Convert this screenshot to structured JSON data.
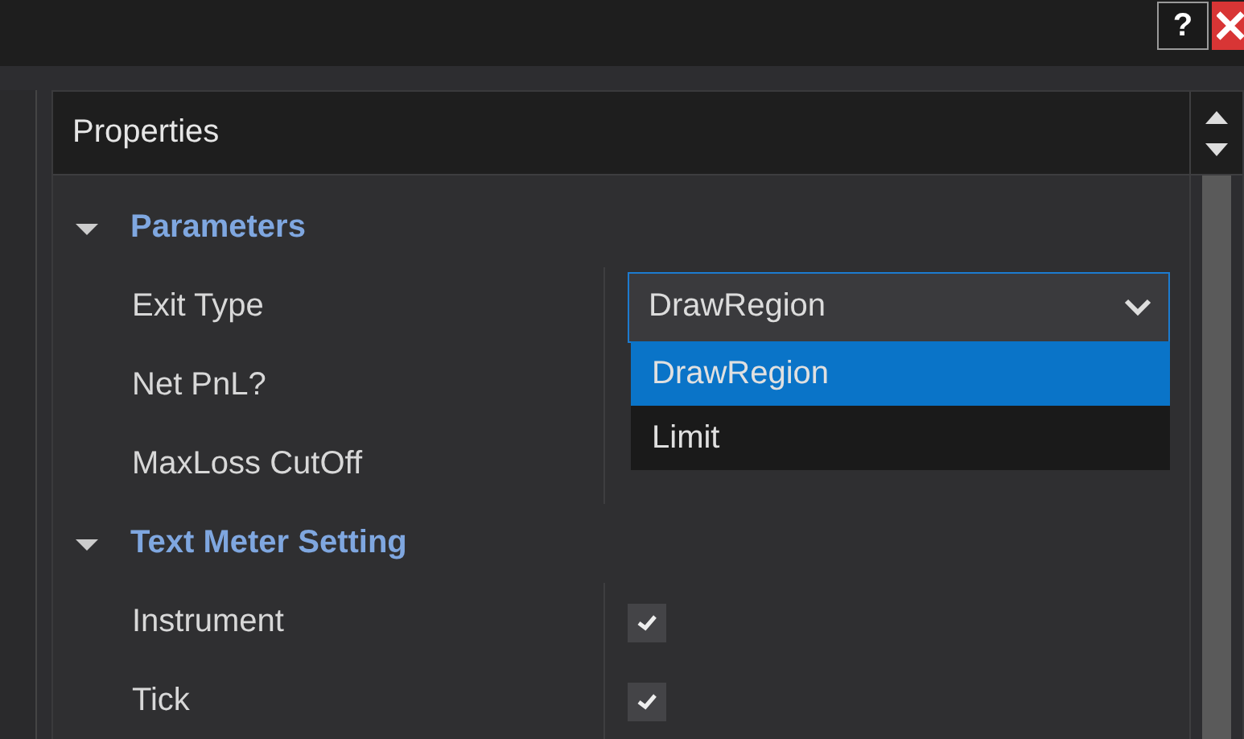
{
  "window": {
    "help_button": "?"
  },
  "panel": {
    "title": "Properties"
  },
  "categories": [
    {
      "name": "Parameters",
      "expanded": true,
      "properties": [
        {
          "name": "Exit Type",
          "kind": "dropdown",
          "value": "DrawRegion",
          "open": true,
          "options": [
            {
              "label": "DrawRegion",
              "selected": true
            },
            {
              "label": "Limit",
              "selected": false
            }
          ]
        },
        {
          "name": "Net PnL?",
          "kind": "hidden"
        },
        {
          "name": "MaxLoss CutOff",
          "kind": "hidden"
        }
      ]
    },
    {
      "name": "Text Meter Setting",
      "expanded": true,
      "properties": [
        {
          "name": "Instrument",
          "kind": "checkbox",
          "checked": true
        },
        {
          "name": "Tick",
          "kind": "checkbox",
          "checked": true
        }
      ]
    }
  ]
}
